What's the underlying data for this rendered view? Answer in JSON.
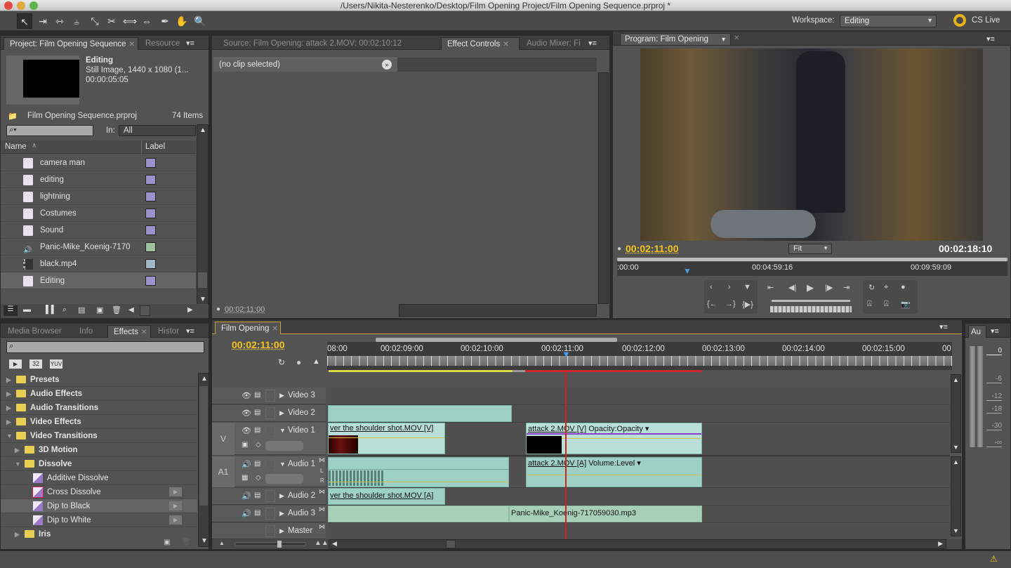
{
  "window": {
    "title": "/Users/Nikita-Nesterenko/Desktop/Film Opening Project/Film Opening Sequence.prproj *"
  },
  "toolbar": {
    "tools": [
      "selection-tool",
      "track-select-tool",
      "ripple-edit-tool",
      "rolling-edit-tool",
      "rate-stretch-tool",
      "razor-tool",
      "slip-tool",
      "slide-tool",
      "pen-tool",
      "hand-tool",
      "zoom-tool"
    ],
    "workspace_label": "Workspace:",
    "workspace_value": "Editing",
    "cs_live": "CS Live"
  },
  "project_panel": {
    "tabs": [
      {
        "label": "Project: Film Opening Sequence",
        "active": true
      },
      {
        "label": "Resource",
        "active": false
      }
    ],
    "preview": {
      "name": "Editing",
      "type": "Still Image, 1440 x 1080 (1...",
      "duration": "00:00:05:05"
    },
    "project_file": "Film Opening Sequence.prproj",
    "item_count": "74 Items",
    "search_placeholder": "",
    "in_label": "In:",
    "in_value": "All",
    "columns": {
      "name": "Name",
      "label": "Label"
    },
    "items": [
      {
        "name": "camera man",
        "type": "sequence",
        "label_color": "#9c93c9"
      },
      {
        "name": "editing",
        "type": "sequence",
        "label_color": "#9c93c9"
      },
      {
        "name": "lightning",
        "type": "sequence",
        "label_color": "#9c93c9"
      },
      {
        "name": "Costumes",
        "type": "sequence",
        "label_color": "#9c93c9"
      },
      {
        "name": "Sound",
        "type": "sequence",
        "label_color": "#9c93c9"
      },
      {
        "name": "Panic-Mike_Koenig-7170",
        "type": "audio",
        "label_color": "#9fc0a0"
      },
      {
        "name": "black.mp4",
        "type": "video",
        "label_color": "#a0b9c3"
      },
      {
        "name": "Editing",
        "type": "sequence",
        "label_color": "#9c93c9",
        "selected": true
      }
    ]
  },
  "source_panel": {
    "tabs": [
      {
        "label": "Source: Film Opening: attack 2.MOV: 00:02:10:12",
        "active": false
      },
      {
        "label": "Effect Controls",
        "active": true
      },
      {
        "label": "Audio Mixer: Fi",
        "active": false
      }
    ],
    "clip_status": "(no clip selected)",
    "timecode": "00:02:11:00"
  },
  "program_panel": {
    "title": "Program: Film Opening",
    "current_timecode": "00:02:11:00",
    "duration_timecode": "00:02:18:10",
    "fit": "Fit",
    "ruler": [
      ":00:00",
      "00:04:59:16",
      "00:09:59:09"
    ]
  },
  "effects_panel": {
    "tabs": [
      {
        "label": "Media Browser",
        "active": false
      },
      {
        "label": "Info",
        "active": false
      },
      {
        "label": "Effects",
        "active": true
      },
      {
        "label": "Histor",
        "active": false
      }
    ],
    "filters": [
      "accelerated-icon",
      "32",
      "YUV"
    ],
    "tree": [
      {
        "label": "Presets",
        "level": 0,
        "expanded": false,
        "kind": "preset-folder"
      },
      {
        "label": "Audio Effects",
        "level": 0,
        "expanded": false,
        "kind": "folder"
      },
      {
        "label": "Audio Transitions",
        "level": 0,
        "expanded": false,
        "kind": "folder"
      },
      {
        "label": "Video Effects",
        "level": 0,
        "expanded": false,
        "kind": "folder"
      },
      {
        "label": "Video Transitions",
        "level": 0,
        "expanded": true,
        "kind": "folder"
      },
      {
        "label": "3D Motion",
        "level": 1,
        "expanded": false,
        "kind": "folder"
      },
      {
        "label": "Dissolve",
        "level": 1,
        "expanded": true,
        "kind": "folder"
      },
      {
        "label": "Additive Dissolve",
        "level": 2,
        "kind": "transition"
      },
      {
        "label": "Cross Dissolve",
        "level": 2,
        "kind": "transition",
        "default": true
      },
      {
        "label": "Dip to Black",
        "level": 2,
        "kind": "transition",
        "selected": true
      },
      {
        "label": "Dip to White",
        "level": 2,
        "kind": "transition"
      },
      {
        "label": "Iris",
        "level": 1,
        "expanded": false,
        "kind": "folder"
      }
    ]
  },
  "timeline": {
    "tab": "Film Opening",
    "timecode": "00:02:11:00",
    "ruler": [
      "08:00",
      "00:02:09:00",
      "00:02:10:00",
      "00:02:11:00",
      "00:02:12:00",
      "00:02:13:00",
      "00:02:14:00",
      "00:02:15:00",
      "00"
    ],
    "tracks": [
      {
        "name": "Video 3",
        "kind": "video"
      },
      {
        "name": "Video 2",
        "kind": "video"
      },
      {
        "name": "Video 1",
        "kind": "video",
        "target": "V",
        "expanded": true
      },
      {
        "name": "Audio 1",
        "kind": "audio",
        "target": "A1",
        "expanded": true
      },
      {
        "name": "Audio 2",
        "kind": "audio"
      },
      {
        "name": "Audio 3",
        "kind": "audio"
      },
      {
        "name": "Master",
        "kind": "master"
      }
    ],
    "clips": {
      "v1a": {
        "name": "ver the shoulder shot.MOV [V]"
      },
      "v1b": {
        "name": "attack 2.MOV [V]",
        "effect": "Opacity:Opacity"
      },
      "a1b": {
        "name": "attack 2.MOV [A]",
        "effect": "Volume:Level"
      },
      "a2a": {
        "name": "ver the shoulder shot.MOV [A]"
      },
      "a3b": {
        "name": "Panic-Mike_Koenig-717059030.mp3"
      }
    }
  },
  "audio_meter": {
    "tab": "Au",
    "scale": [
      "0",
      "-6",
      "-12",
      "-18",
      "-30",
      "-∞"
    ]
  },
  "colors": {
    "timecode": "#f5c519",
    "clip": "#9fd0c5",
    "playhead": "#cc2222",
    "panel": "#535353"
  }
}
